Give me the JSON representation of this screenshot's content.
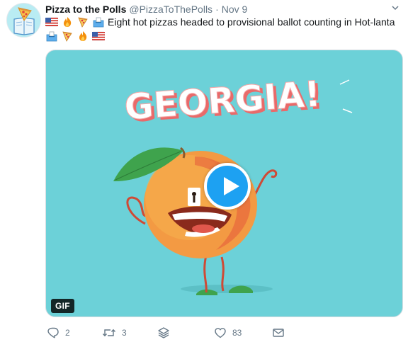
{
  "tweet": {
    "author_name": "Pizza to the Polls",
    "handle": "@PizzaToThePolls",
    "separator": "·",
    "timestamp": "Nov 9",
    "text_line1": "Eight hot pizzas headed to provisional ballot counting in Hot-lanta",
    "emojis_line1": [
      "us-flag-icon",
      "fire-icon",
      "pizza-icon",
      "ballot-box-icon"
    ],
    "emojis_line2": [
      "ballot-box-icon",
      "pizza-icon",
      "fire-icon",
      "us-flag-icon"
    ]
  },
  "media": {
    "headline": "GEORGIA!",
    "badge": "GIF",
    "background_color": "#6cd1d8",
    "play_color": "#1da1f2"
  },
  "actions": {
    "reply_count": "2",
    "retweet_count": "3",
    "like_count": "83"
  }
}
